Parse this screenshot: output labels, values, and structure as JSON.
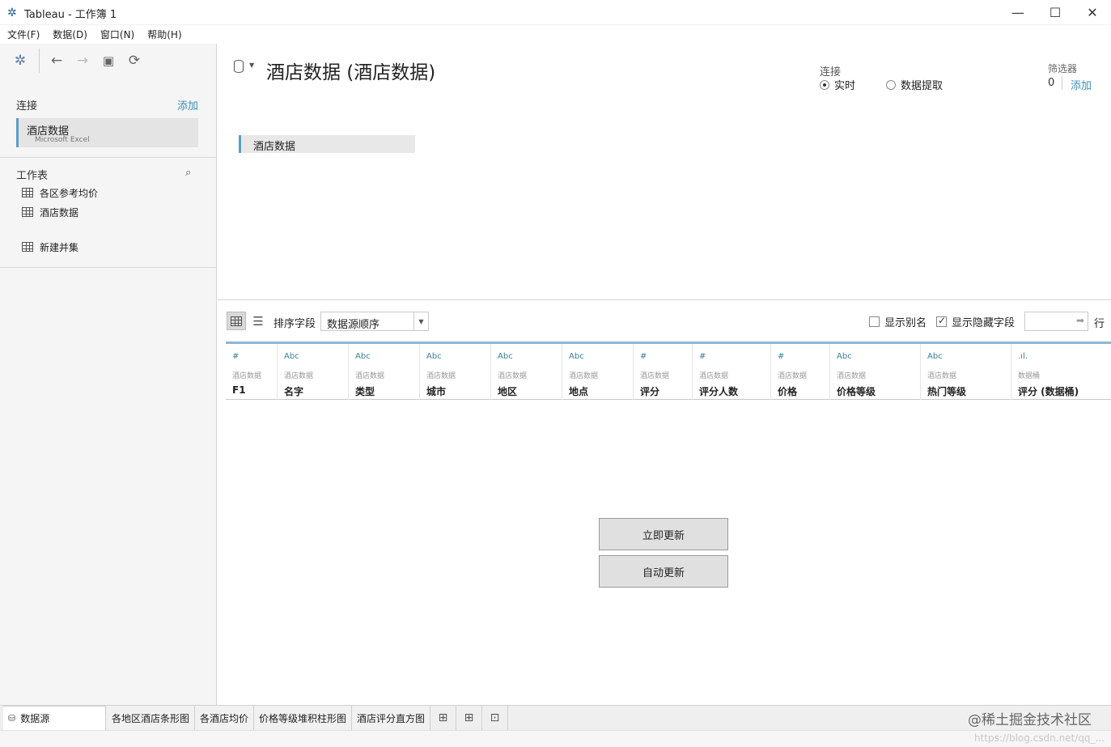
{
  "window": {
    "title": "Tableau - 工作簿 1",
    "logo": "✲",
    "minimize": "—",
    "maximize": "☐",
    "close": "✕"
  },
  "menu": [
    "文件(F)",
    "数据(D)",
    "窗口(N)",
    "帮助(H)"
  ],
  "left": {
    "toolbar": {
      "home": "✲",
      "back": "←",
      "forward": "→",
      "save": "▣",
      "refresh": "⟳"
    },
    "connections": {
      "title": "连接",
      "add": "添加",
      "item": {
        "name": "酒店数据",
        "type": "Microsoft Excel"
      }
    },
    "sheets": {
      "title": "工作表",
      "search": "⌕",
      "items": [
        "各区参考均价",
        "酒店数据"
      ]
    },
    "new_union": "新建并集"
  },
  "main": {
    "title": "酒店数据 (酒店数据)",
    "connection": {
      "label": "连接",
      "options": [
        "实时",
        "数据提取"
      ],
      "selected": "实时"
    },
    "filters": {
      "label": "筛选器",
      "count": "0",
      "add": "添加"
    },
    "canvas_table": "酒店数据",
    "gridbar": {
      "sort_label": "排序字段",
      "sort_value": "数据源顺序",
      "show_alias": "显示别名",
      "show_hidden": "显示隐藏字段",
      "rows_label": "行"
    },
    "columns": [
      {
        "type": "#",
        "source": "酒店数据",
        "name": "F1"
      },
      {
        "type": "Abc",
        "source": "酒店数据",
        "name": "名字"
      },
      {
        "type": "Abc",
        "source": "酒店数据",
        "name": "类型"
      },
      {
        "type": "Abc",
        "source": "酒店数据",
        "name": "城市"
      },
      {
        "type": "Abc",
        "source": "酒店数据",
        "name": "地区"
      },
      {
        "type": "Abc",
        "source": "酒店数据",
        "name": "地点"
      },
      {
        "type": "#",
        "source": "酒店数据",
        "name": "评分"
      },
      {
        "type": "#",
        "source": "酒店数据",
        "name": "评分人数"
      },
      {
        "type": "#",
        "source": "酒店数据",
        "name": "价格"
      },
      {
        "type": "Abc",
        "source": "酒店数据",
        "name": "价格等级"
      },
      {
        "type": "Abc",
        "source": "酒店数据",
        "name": "热门等级"
      },
      {
        "type": ".ıl.",
        "source": "数据桶",
        "name": "评分 (数据桶)"
      }
    ],
    "update_now": "立即更新",
    "auto_update": "自动更新"
  },
  "tabs": {
    "datasource": "数据源",
    "sheets": [
      "各地区酒店条形图",
      "各酒店均价",
      "价格等级堆积柱形图",
      "酒店评分直方图"
    ]
  },
  "watermark": "@稀土掘金技术社区",
  "status_url": "https://blog.csdn.net/qq_..."
}
